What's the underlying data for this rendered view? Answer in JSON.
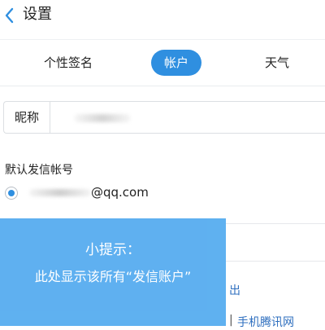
{
  "header": {
    "title": "设置",
    "back_icon": "chevron-left-icon"
  },
  "tabs": [
    {
      "label": "个性签名",
      "active": false
    },
    {
      "label": "帐户",
      "active": true
    },
    {
      "label": "天气",
      "active": false
    }
  ],
  "nickname": {
    "label": "昵称",
    "value": ""
  },
  "default_sender": {
    "heading": "默认发信帐号",
    "account_domain": "@qq.com",
    "selected": true
  },
  "lower": {
    "logout_partial": "出",
    "footer_separator": "|",
    "footer_link": "手机腾讯网"
  },
  "tip": {
    "title": "小提示：",
    "body": "此处显示该所有“发信账户”"
  },
  "colors": {
    "accent": "#2f8fe0",
    "tip_bg": "#5aaef0",
    "link": "#2f6fbf"
  }
}
